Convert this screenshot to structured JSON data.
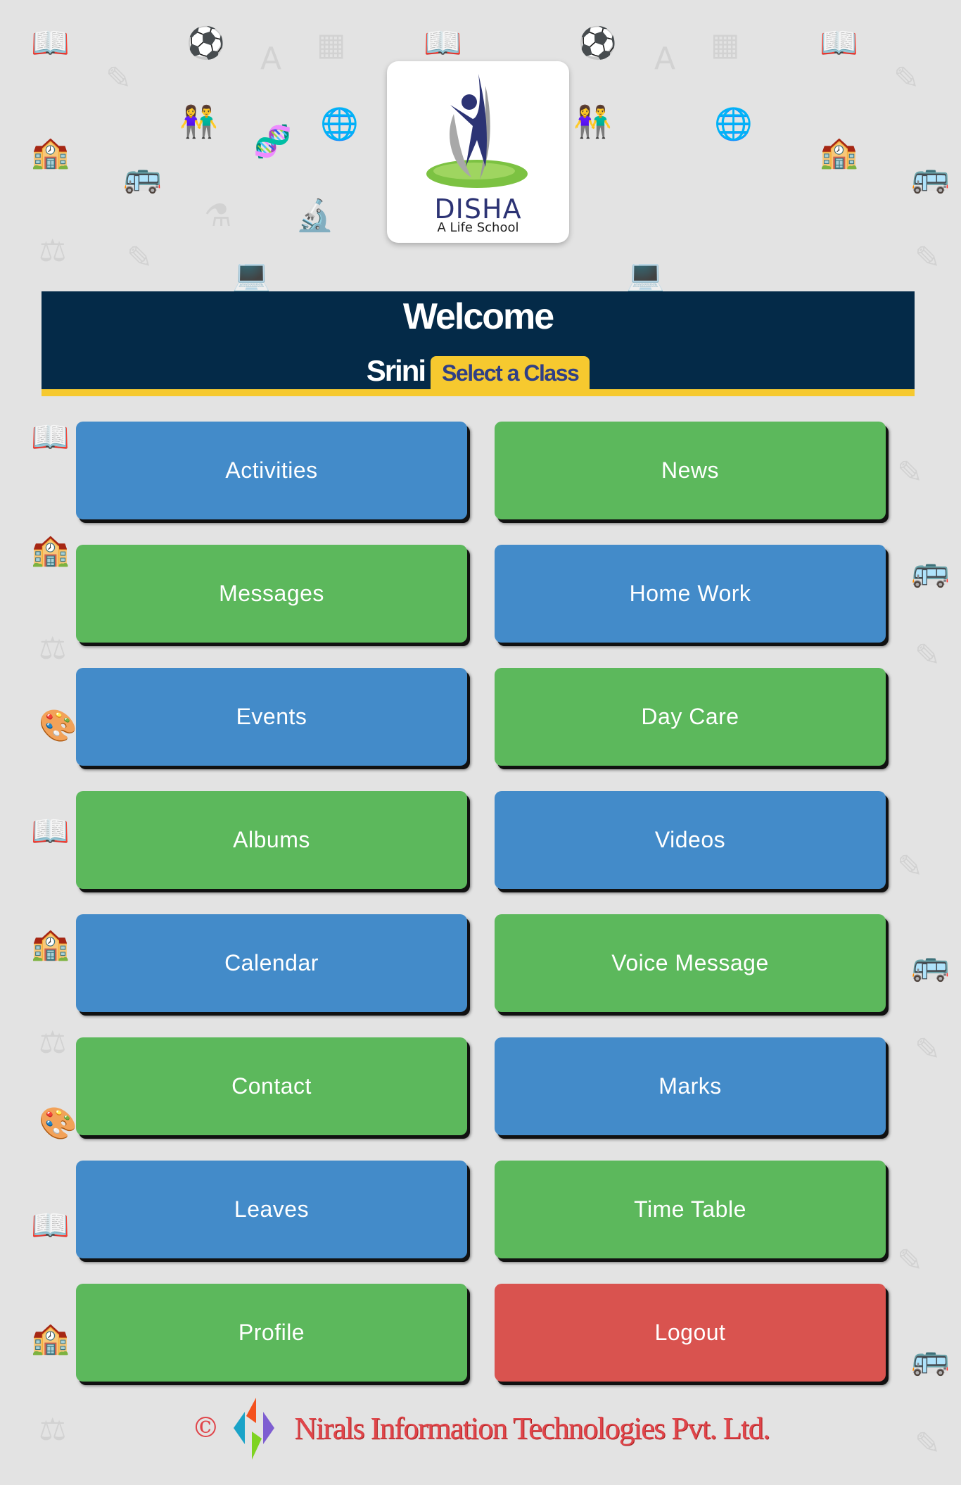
{
  "logo": {
    "title": "DISHA",
    "subtitle": "A Life School"
  },
  "header": {
    "welcome": "Welcome",
    "user_name": "Srini",
    "select_class_label": "Select a Class"
  },
  "menu": [
    {
      "label": "Activities",
      "color": "blue"
    },
    {
      "label": "News",
      "color": "green"
    },
    {
      "label": "Messages",
      "color": "green"
    },
    {
      "label": "Home Work",
      "color": "blue"
    },
    {
      "label": "Events",
      "color": "blue"
    },
    {
      "label": "Day Care",
      "color": "green"
    },
    {
      "label": "Albums",
      "color": "green"
    },
    {
      "label": "Videos",
      "color": "blue"
    },
    {
      "label": "Calendar",
      "color": "blue"
    },
    {
      "label": "Voice Message",
      "color": "green"
    },
    {
      "label": "Contact",
      "color": "green"
    },
    {
      "label": "Marks",
      "color": "blue"
    },
    {
      "label": "Leaves",
      "color": "blue"
    },
    {
      "label": "Time Table",
      "color": "green"
    },
    {
      "label": "Profile",
      "color": "green"
    },
    {
      "label": "Logout",
      "color": "red"
    }
  ],
  "colors": {
    "blue": "#438bc9",
    "green": "#5cb85c",
    "red": "#d9534f",
    "header_bg": "#042a48",
    "accent_yellow": "#f6c92f",
    "footer_text": "#e0454a"
  },
  "footer": {
    "copyright_symbol": "©",
    "company": "Nirals Information Technologies Pvt. Ltd."
  },
  "background_icons": [
    "book-icon",
    "basketball-icon",
    "letter-a-icon",
    "blocks-icon",
    "pencil-icon",
    "kids-icon",
    "dna-icon",
    "globe-icon",
    "school-icon",
    "bus-icon",
    "flask-icon",
    "microscope-icon",
    "seesaw-icon",
    "laptop-icon",
    "apple-icon",
    "palette-icon"
  ]
}
